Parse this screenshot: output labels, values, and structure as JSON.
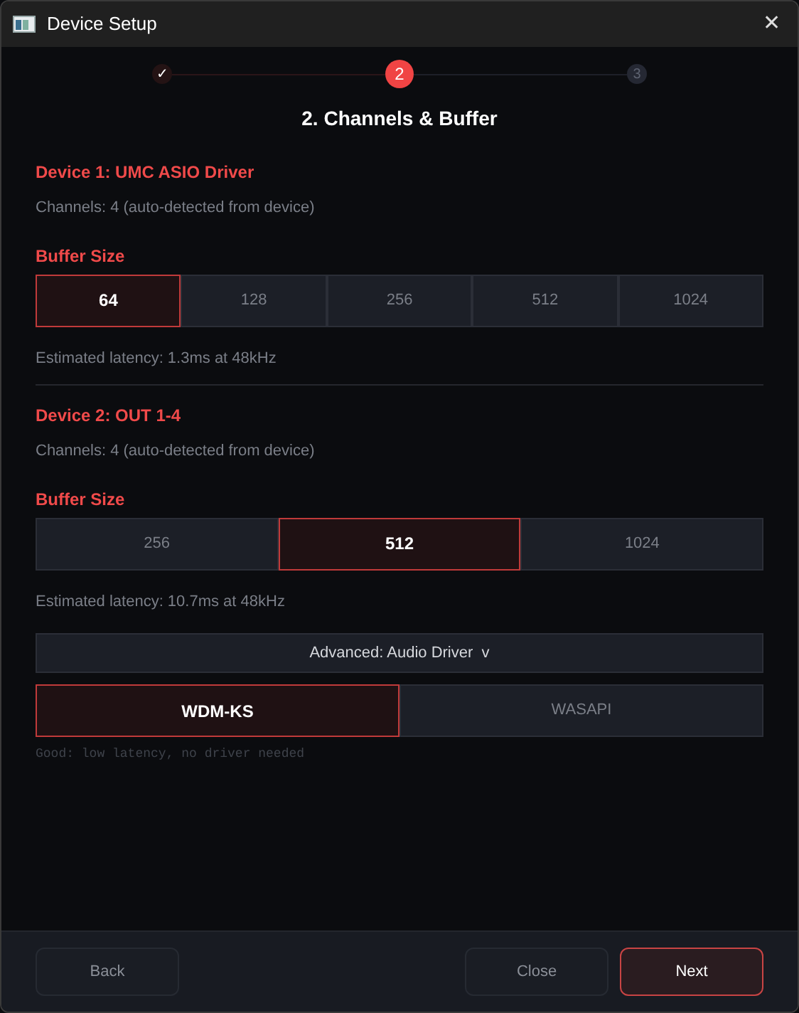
{
  "window": {
    "title": "Device Setup",
    "close": "✕"
  },
  "steps": [
    {
      "label": "✓",
      "completed": true,
      "selected": false
    },
    {
      "label": "2",
      "completed": false,
      "selected": true
    },
    {
      "label": "3",
      "completed": false,
      "selected": false
    }
  ],
  "heading": "2. Channels & Buffer",
  "devices": [
    {
      "name": "Device 1: UMC ASIO Driver",
      "channels": "Channels: 4 (auto-detected from device)",
      "buffer_label": "Buffer Size",
      "buffers": [
        {
          "label": "64",
          "selected": true
        },
        {
          "label": "128",
          "selected": false
        },
        {
          "label": "256",
          "selected": false
        },
        {
          "label": "512",
          "selected": false
        },
        {
          "label": "1024",
          "selected": false
        }
      ],
      "latency": "Estimated latency: 1.3ms at 48kHz"
    },
    {
      "name": "Device 2: OUT 1-4",
      "channels": "Channels: 4 (auto-detected from device)",
      "buffer_label": "Buffer Size",
      "buffers": [
        {
          "label": "256",
          "selected": false
        },
        {
          "label": "512",
          "selected": true
        },
        {
          "label": "1024",
          "selected": false
        }
      ],
      "latency": "Estimated latency: 10.7ms at 48kHz"
    }
  ],
  "advanced": {
    "label": "Advanced: Audio Driver  v",
    "drivers": [
      {
        "label": "WDM-KS",
        "selected": true
      },
      {
        "label": "WASAPI",
        "selected": false
      }
    ],
    "hint": "Good: low latency, no driver needed"
  },
  "footer": {
    "back": "Back",
    "close": "Close",
    "next": "Next"
  }
}
